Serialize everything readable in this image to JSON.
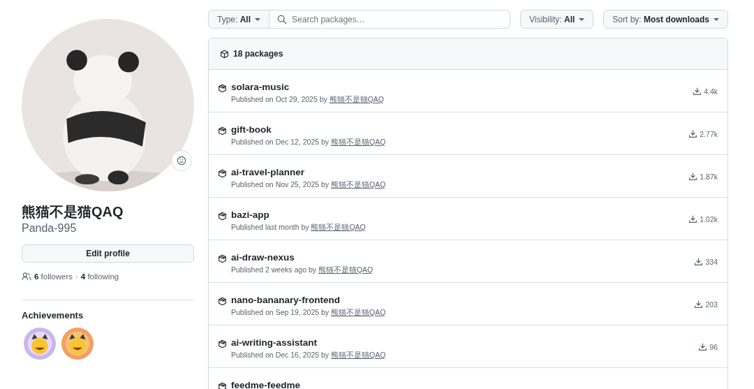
{
  "profile": {
    "name": "熊猫不是猫QAQ",
    "username": "Panda-995",
    "edit_button": "Edit profile",
    "followers_count": "6",
    "followers_label": "followers",
    "separator": "·",
    "following_count": "4",
    "following_label": "following"
  },
  "achievements": {
    "title": "Achievements"
  },
  "filters": {
    "type": {
      "label": "Type:",
      "value": "All"
    },
    "search": {
      "placeholder": "Search packages…"
    },
    "visibility": {
      "label": "Visibility:",
      "value": "All"
    },
    "sort": {
      "label": "Sort by:",
      "value": "Most downloads"
    }
  },
  "packages": {
    "count": "18 packages",
    "items": [
      {
        "name": "solara-music",
        "published": "Published on Oct 29, 2025 by",
        "author": "熊猫不是猫QAQ",
        "downloads": "4.4k"
      },
      {
        "name": "gift-book",
        "published": "Published on Dec 12, 2025 by",
        "author": "熊猫不是猫QAQ",
        "downloads": "2.77k"
      },
      {
        "name": "ai-travel-planner",
        "published": "Published on Nov 25, 2025 by",
        "author": "熊猫不是猫QAQ",
        "downloads": "1.87k"
      },
      {
        "name": "bazi-app",
        "published": "Published last month by",
        "author": "熊猫不是猫QAQ",
        "downloads": "1.02k"
      },
      {
        "name": "ai-draw-nexus",
        "published": "Published 2 weeks ago by",
        "author": "熊猫不是猫QAQ",
        "downloads": "334"
      },
      {
        "name": "nano-bananary-frontend",
        "published": "Published on Sep 19, 2025 by",
        "author": "熊猫不是猫QAQ",
        "downloads": "203"
      },
      {
        "name": "ai-writing-assistant",
        "published": "Published on Dec 16, 2025 by",
        "author": "熊猫不是猫QAQ",
        "downloads": "96"
      },
      {
        "name": "feedme-feedme"
      }
    ]
  }
}
